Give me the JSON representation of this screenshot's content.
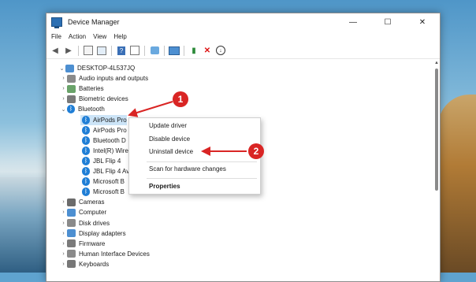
{
  "window": {
    "title": "Device Manager",
    "controls": [
      "—",
      "☐",
      "✕"
    ]
  },
  "menu": [
    "File",
    "Action",
    "View",
    "Help"
  ],
  "toolbar_icons": [
    "back-icon",
    "forward-icon",
    "properties-icon",
    "view-icon",
    "help-icon",
    "scan-icon",
    "computer-icon",
    "update-driver-icon",
    "remove-icon",
    "download-icon"
  ],
  "tree": {
    "root": "DESKTOP-4L537JQ",
    "categories_top": [
      "Audio inputs and outputs",
      "Batteries",
      "Biometric devices",
      "Bluetooth"
    ],
    "bluetooth_children": [
      "AirPods Pro",
      "AirPods Pro",
      "Bluetooth D",
      "Intel(R) Wire",
      "JBL Flip 4",
      "JBL Flip 4 Av",
      "Microsoft B",
      "Microsoft B"
    ],
    "categories_bottom": [
      "Cameras",
      "Computer",
      "Disk drives",
      "Display adapters",
      "Firmware",
      "Human Interface Devices",
      "Keyboards"
    ]
  },
  "context_menu": {
    "items": [
      "Update driver",
      "Disable device",
      "Uninstall device",
      "Scan for hardware changes",
      "Properties"
    ]
  },
  "annotations": [
    "1",
    "2"
  ],
  "colors": {
    "accent": "#1f7ed6",
    "badge": "#d92524",
    "selection": "#cce4f7"
  }
}
